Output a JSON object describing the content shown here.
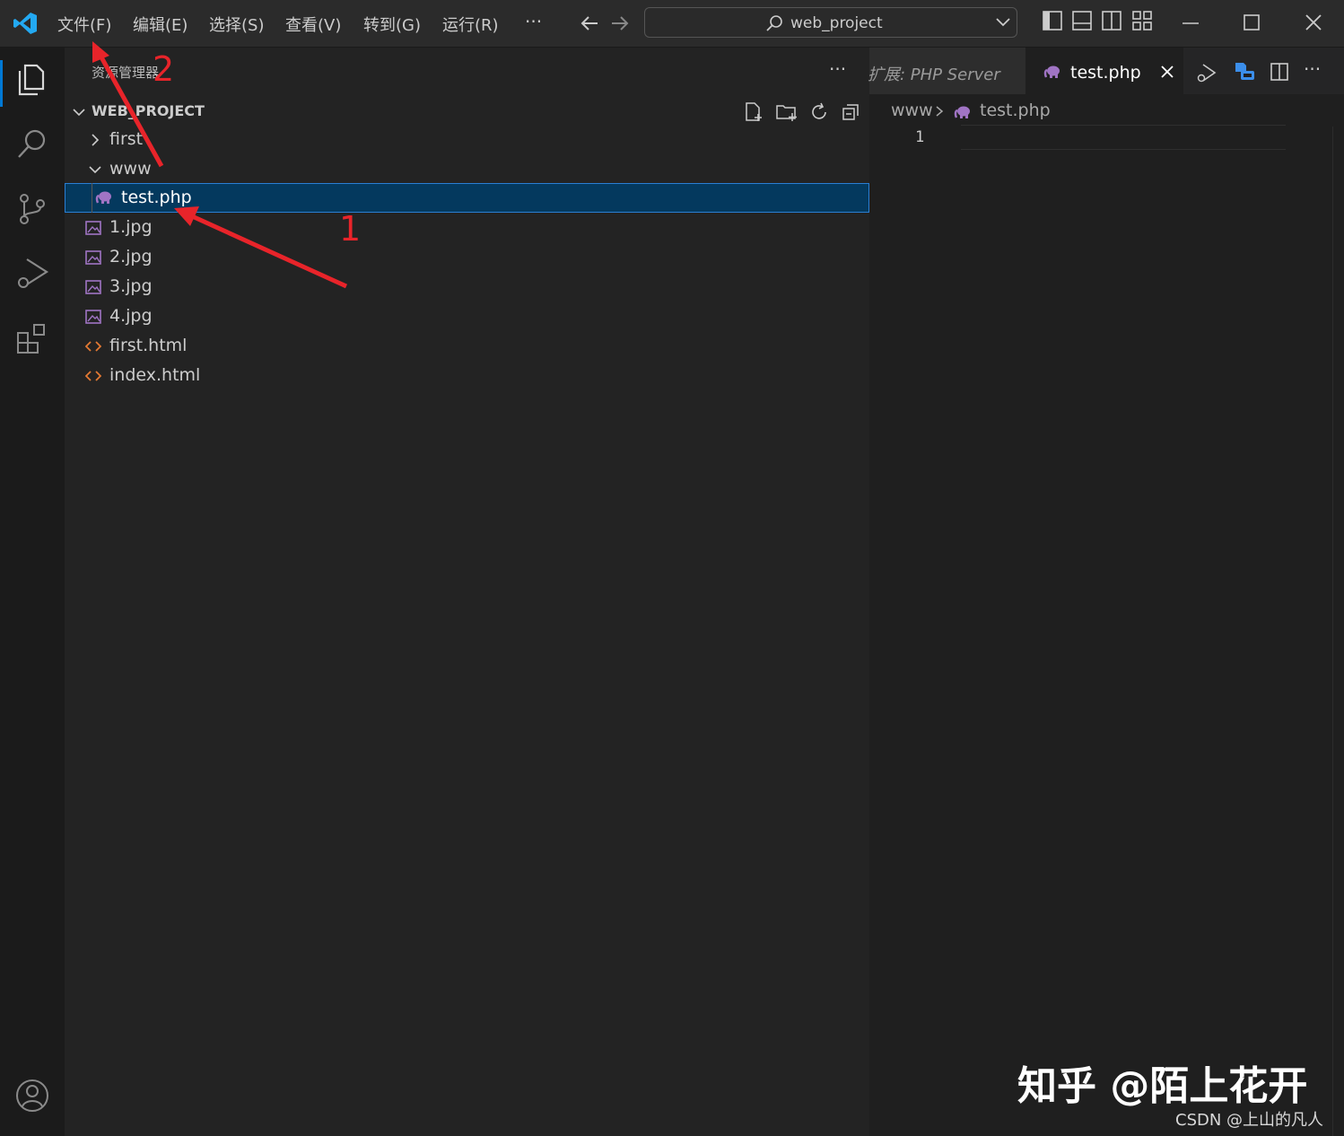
{
  "titlebar": {
    "menus": [
      "文件(F)",
      "编辑(E)",
      "选择(S)",
      "查看(V)",
      "转到(G)",
      "运行(R)"
    ],
    "more": "···",
    "search_text": "web_project"
  },
  "sidebar": {
    "title": "资源管理器",
    "more": "···",
    "project": "WEB_PROJECT",
    "items": [
      {
        "label": "first",
        "kind": "folder-collapsed"
      },
      {
        "label": "www",
        "kind": "folder-expanded"
      },
      {
        "label": "test.php",
        "kind": "php",
        "selected": true
      },
      {
        "label": "1.jpg",
        "kind": "image"
      },
      {
        "label": "2.jpg",
        "kind": "image"
      },
      {
        "label": "3.jpg",
        "kind": "image"
      },
      {
        "label": "4.jpg",
        "kind": "image"
      },
      {
        "label": "first.html",
        "kind": "html"
      },
      {
        "label": "index.html",
        "kind": "html"
      }
    ]
  },
  "editor": {
    "tab_extension": "扩展: PHP Server",
    "tab_active": "test.php",
    "breadcrumb": [
      "www",
      "test.php"
    ],
    "line_numbers": [
      "1"
    ]
  },
  "annotations": {
    "arrow_1": "1",
    "arrow_2": "2"
  },
  "watermark": {
    "main": "知乎 @陌上花开",
    "sub": "CSDN @上山的凡人"
  },
  "colors": {
    "accent": "#0078d4",
    "selection": "#04395e",
    "php": "#a074c4",
    "html": "#e37933",
    "arrow": "#e8242a"
  }
}
